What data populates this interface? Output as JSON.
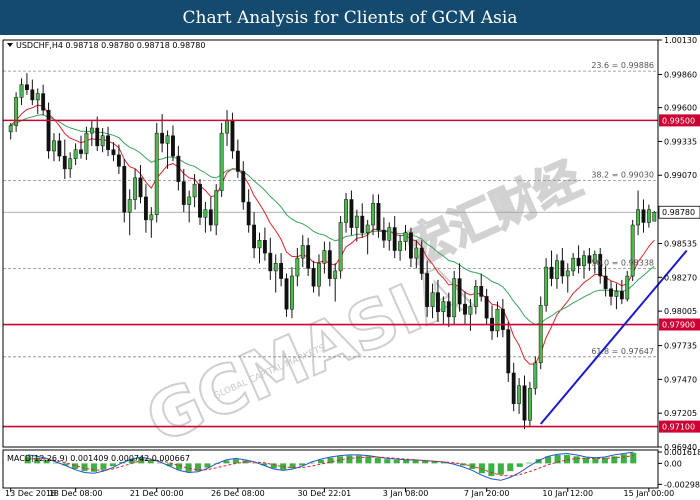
{
  "banner": {
    "title": "Chart Analysis for Clients of GCM Asia"
  },
  "header": {
    "symbol_line": "USDCHF,H4  0.98718 0.98780 0.98718 0.98780",
    "macd_label": "MACD(12,26,9) 0.001409 0.000742 0.000667"
  },
  "watermark": {
    "brand": "GCMASIA",
    "sub": "GLOBAL CAPITAL MARKETS",
    "cn": "宏汇财经"
  },
  "colors": {
    "bull": "#4db84d",
    "bear": "#111111",
    "ema_fast": "#d9262c",
    "ema_slow": "#3aa35c",
    "level": "#cc0033",
    "trend": "#1a1acc",
    "macd_signal": "#d9262c",
    "macd_main": "#2255cc",
    "hist": "#3cb043",
    "banner": "#134a6e"
  },
  "chart_data": {
    "type": "candlestick",
    "symbol": "USDCHF",
    "timeframe": "H4",
    "ylim": [
      0.9694,
      1.0013
    ],
    "price_ticks": [
      "1.00130",
      "0.99860",
      "0.99600",
      "0.99335",
      "0.99070",
      "0.98535",
      "0.98270",
      "0.98005",
      "0.97735",
      "0.97470",
      "0.97205",
      "0.96940"
    ],
    "price_tick_values": [
      1.0013,
      0.9986,
      0.996,
      0.99335,
      0.9907,
      0.98535,
      0.9827,
      0.98005,
      0.97735,
      0.9747,
      0.97205,
      0.9694
    ],
    "x_labels": [
      "13 Dec 2018",
      "18 Dec 08:00",
      "21 Dec 00:00",
      "26 Dec 08:00",
      "30 Dec 22:01",
      "3 Jan 08:00",
      "7 Jan 20:00",
      "10 Jan 12:00",
      "15 Jan 00:00"
    ],
    "x_label_index": [
      0,
      12,
      27,
      42,
      58,
      73,
      88,
      103,
      118
    ],
    "horizontal_levels": [
      {
        "value": 0.995,
        "label": "0.99500"
      },
      {
        "value": 0.979,
        "label": "0.97900"
      },
      {
        "value": 0.971,
        "label": "0.97100"
      }
    ],
    "fibonacci": [
      {
        "ratio": "23.6",
        "value": 0.99886,
        "label": "23.6 = 0.99886"
      },
      {
        "ratio": "38.2",
        "value": 0.9903,
        "label": "38.2 = 0.99030"
      },
      {
        "ratio": "50.0",
        "value": 0.98338,
        "label": "50.0 = 0.98338"
      },
      {
        "ratio": "61.8",
        "value": 0.97647,
        "label": "61.8 = 0.97647"
      }
    ],
    "current_price": {
      "value": 0.9878,
      "label": "0.98780"
    },
    "trendline": [
      {
        "i": 98,
        "p": 0.9712
      },
      {
        "i": 125,
        "p": 0.9848
      }
    ],
    "candles": [
      [
        0.9941,
        0.9948,
        0.9935,
        0.9946
      ],
      [
        0.9946,
        0.9972,
        0.9941,
        0.9968
      ],
      [
        0.9968,
        0.9983,
        0.9962,
        0.9978
      ],
      [
        0.9978,
        0.9987,
        0.997,
        0.9974
      ],
      [
        0.9974,
        0.9982,
        0.9962,
        0.9966
      ],
      [
        0.9966,
        0.9975,
        0.9955,
        0.9971
      ],
      [
        0.9971,
        0.9978,
        0.9954,
        0.9958
      ],
      [
        0.9958,
        0.9964,
        0.992,
        0.9926
      ],
      [
        0.9926,
        0.994,
        0.9918,
        0.9934
      ],
      [
        0.9934,
        0.994,
        0.9918,
        0.9922
      ],
      [
        0.9922,
        0.9935,
        0.9904,
        0.9912
      ],
      [
        0.9912,
        0.9925,
        0.9905,
        0.992
      ],
      [
        0.992,
        0.9932,
        0.9915,
        0.9927
      ],
      [
        0.9927,
        0.9938,
        0.992,
        0.9924
      ],
      [
        0.9924,
        0.9945,
        0.9919,
        0.994
      ],
      [
        0.994,
        0.995,
        0.993,
        0.9944
      ],
      [
        0.9944,
        0.9953,
        0.9926,
        0.993
      ],
      [
        0.993,
        0.9944,
        0.9925,
        0.9938
      ],
      [
        0.9938,
        0.9945,
        0.9922,
        0.9927
      ],
      [
        0.9927,
        0.9933,
        0.9918,
        0.9923
      ],
      [
        0.9923,
        0.9931,
        0.9908,
        0.9914
      ],
      [
        0.9914,
        0.992,
        0.987,
        0.9878
      ],
      [
        0.9878,
        0.9896,
        0.986,
        0.9888
      ],
      [
        0.9888,
        0.9912,
        0.988,
        0.9905
      ],
      [
        0.9905,
        0.9915,
        0.9885,
        0.989
      ],
      [
        0.989,
        0.99,
        0.9862,
        0.9872
      ],
      [
        0.9872,
        0.9882,
        0.9858,
        0.9876
      ],
      [
        0.9876,
        0.9948,
        0.987,
        0.994
      ],
      [
        0.994,
        0.9955,
        0.9925,
        0.9932
      ],
      [
        0.9932,
        0.9942,
        0.9912,
        0.9938
      ],
      [
        0.9938,
        0.9946,
        0.9918,
        0.9922
      ],
      [
        0.9922,
        0.993,
        0.9895,
        0.9902
      ],
      [
        0.9902,
        0.9912,
        0.9878,
        0.9884
      ],
      [
        0.9884,
        0.9895,
        0.987,
        0.989
      ],
      [
        0.989,
        0.9908,
        0.9882,
        0.99
      ],
      [
        0.99,
        0.9904,
        0.9868,
        0.9874
      ],
      [
        0.9874,
        0.9886,
        0.9862,
        0.988
      ],
      [
        0.988,
        0.989,
        0.9863,
        0.9868
      ],
      [
        0.9868,
        0.99,
        0.986,
        0.9895
      ],
      [
        0.9895,
        0.9948,
        0.989,
        0.994
      ],
      [
        0.994,
        0.9958,
        0.993,
        0.995
      ],
      [
        0.995,
        0.9956,
        0.992,
        0.9926
      ],
      [
        0.9926,
        0.9935,
        0.9905,
        0.991
      ],
      [
        0.991,
        0.9918,
        0.988,
        0.9886
      ],
      [
        0.9886,
        0.9896,
        0.9862,
        0.9868
      ],
      [
        0.9868,
        0.9878,
        0.9842,
        0.985
      ],
      [
        0.985,
        0.9862,
        0.9838,
        0.9856
      ],
      [
        0.9856,
        0.9866,
        0.984,
        0.9846
      ],
      [
        0.9846,
        0.9858,
        0.9825,
        0.9832
      ],
      [
        0.9832,
        0.9845,
        0.9815,
        0.9838
      ],
      [
        0.9838,
        0.9846,
        0.982,
        0.9826
      ],
      [
        0.9826,
        0.983,
        0.9796,
        0.9802
      ],
      [
        0.9802,
        0.9835,
        0.9795,
        0.9828
      ],
      [
        0.9828,
        0.985,
        0.982,
        0.9842
      ],
      [
        0.9842,
        0.986,
        0.9835,
        0.9852
      ],
      [
        0.9852,
        0.9858,
        0.9828,
        0.9834
      ],
      [
        0.9834,
        0.984,
        0.9815,
        0.982
      ],
      [
        0.982,
        0.9845,
        0.9812,
        0.9838
      ],
      [
        0.9838,
        0.9855,
        0.983,
        0.9848
      ],
      [
        0.9848,
        0.9855,
        0.982,
        0.9826
      ],
      [
        0.9826,
        0.9838,
        0.9808,
        0.9832
      ],
      [
        0.9832,
        0.9875,
        0.9826,
        0.987
      ],
      [
        0.987,
        0.9893,
        0.9862,
        0.9888
      ],
      [
        0.9888,
        0.9895,
        0.986,
        0.9866
      ],
      [
        0.9866,
        0.988,
        0.9855,
        0.9875
      ],
      [
        0.9875,
        0.9885,
        0.9858,
        0.9862
      ],
      [
        0.9862,
        0.9872,
        0.9845,
        0.9868
      ],
      [
        0.9868,
        0.9892,
        0.986,
        0.9885
      ],
      [
        0.9885,
        0.9892,
        0.9858,
        0.9864
      ],
      [
        0.9864,
        0.9874,
        0.985,
        0.9856
      ],
      [
        0.9856,
        0.987,
        0.9848,
        0.9866
      ],
      [
        0.9866,
        0.9875,
        0.9842,
        0.9848
      ],
      [
        0.9848,
        0.986,
        0.984,
        0.9855
      ],
      [
        0.9855,
        0.9868,
        0.9848,
        0.9862
      ],
      [
        0.9862,
        0.9866,
        0.9835,
        0.9842
      ],
      [
        0.9842,
        0.9856,
        0.9834,
        0.985
      ],
      [
        0.985,
        0.9856,
        0.9825,
        0.983
      ],
      [
        0.983,
        0.984,
        0.9796,
        0.9804
      ],
      [
        0.9804,
        0.9822,
        0.9795,
        0.9815
      ],
      [
        0.9815,
        0.9825,
        0.9792,
        0.98
      ],
      [
        0.98,
        0.9812,
        0.979,
        0.9808
      ],
      [
        0.9808,
        0.9815,
        0.9788,
        0.9796
      ],
      [
        0.9796,
        0.9832,
        0.979,
        0.9826
      ],
      [
        0.9826,
        0.9838,
        0.98,
        0.9806
      ],
      [
        0.9806,
        0.9816,
        0.979,
        0.9798
      ],
      [
        0.9798,
        0.981,
        0.9785,
        0.9804
      ],
      [
        0.9804,
        0.9825,
        0.9798,
        0.982
      ],
      [
        0.982,
        0.983,
        0.9808,
        0.9812
      ],
      [
        0.9812,
        0.9818,
        0.979,
        0.9795
      ],
      [
        0.9795,
        0.9805,
        0.9778,
        0.9785
      ],
      [
        0.9785,
        0.9808,
        0.978,
        0.9802
      ],
      [
        0.9802,
        0.981,
        0.978,
        0.9786
      ],
      [
        0.9786,
        0.9792,
        0.9745,
        0.9752
      ],
      [
        0.9752,
        0.976,
        0.9722,
        0.9728
      ],
      [
        0.9728,
        0.9748,
        0.972,
        0.9742
      ],
      [
        0.9742,
        0.975,
        0.9708,
        0.9715
      ],
      [
        0.9715,
        0.9745,
        0.971,
        0.974
      ],
      [
        0.974,
        0.9765,
        0.9735,
        0.976
      ],
      [
        0.976,
        0.9812,
        0.9755,
        0.9805
      ],
      [
        0.9805,
        0.9842,
        0.98,
        0.9835
      ],
      [
        0.9835,
        0.9848,
        0.982,
        0.9826
      ],
      [
        0.9826,
        0.9845,
        0.9818,
        0.984
      ],
      [
        0.984,
        0.985,
        0.9822,
        0.9828
      ],
      [
        0.9828,
        0.9838,
        0.9815,
        0.9832
      ],
      [
        0.9832,
        0.9846,
        0.9828,
        0.9842
      ],
      [
        0.9842,
        0.9852,
        0.983,
        0.9836
      ],
      [
        0.9836,
        0.9848,
        0.9826,
        0.9844
      ],
      [
        0.9844,
        0.985,
        0.9832,
        0.9838
      ],
      [
        0.9838,
        0.9848,
        0.983,
        0.9845
      ],
      [
        0.9845,
        0.985,
        0.9822,
        0.9828
      ],
      [
        0.9828,
        0.9836,
        0.9812,
        0.9818
      ],
      [
        0.9818,
        0.9824,
        0.9805,
        0.9812
      ],
      [
        0.9812,
        0.9822,
        0.9802,
        0.9816
      ],
      [
        0.9816,
        0.9825,
        0.9806,
        0.981
      ],
      [
        0.981,
        0.9832,
        0.9808,
        0.9828
      ],
      [
        0.9828,
        0.9872,
        0.9824,
        0.9868
      ],
      [
        0.9868,
        0.9895,
        0.986,
        0.988
      ],
      [
        0.988,
        0.9888,
        0.9862,
        0.987
      ],
      [
        0.987,
        0.9884,
        0.9866,
        0.988
      ],
      [
        0.9871,
        0.9879,
        0.9871,
        0.9878
      ]
    ],
    "macd": {
      "label": "MACD(12,26,9)",
      "ylim": [
        -0.0035,
        0.0019
      ],
      "ticks": [
        "0.001618",
        "0.00",
        "-0.00298"
      ],
      "tick_values": [
        0.001618,
        0.0,
        -0.00298
      ],
      "hist": [
        0.001,
        0.0008,
        0.0005,
        0.0001,
        -0.0003,
        -0.0008,
        -0.0011,
        -0.0012,
        -0.0009,
        -0.0004,
        0.0002,
        0.0006,
        0.0008,
        0.0005,
        0.0001,
        -0.0004,
        -0.0009,
        -0.0012,
        -0.0011,
        -0.0006,
        0.0,
        0.0004,
        0.0006,
        0.0004,
        0.0001,
        -0.0003,
        -0.0007,
        -0.0009,
        -0.0007,
        -0.0003,
        0.0001,
        0.0005,
        0.0008,
        0.001,
        0.0011,
        0.0011,
        0.001,
        0.0008,
        0.0006,
        0.0005,
        0.0005,
        0.0005,
        0.0004,
        0.0003,
        0.0002,
        0.0,
        -0.0003,
        -0.0008,
        -0.0014,
        -0.0018,
        -0.0016,
        -0.0011,
        -0.0005,
        0.0001,
        0.0006,
        0.001,
        0.0012,
        0.0012,
        0.001,
        0.0008,
        0.0007,
        0.0008,
        0.001,
        0.0013,
        0.0015
      ],
      "signal": [
        0.0006,
        0.0007,
        0.0006,
        0.0004,
        0.0001,
        -0.0003,
        -0.0007,
        -0.0009,
        -0.001,
        -0.0008,
        -0.0004,
        0.0,
        0.0004,
        0.0005,
        0.0004,
        0.0001,
        -0.0003,
        -0.0007,
        -0.0009,
        -0.0009,
        -0.0006,
        -0.0003,
        0.0,
        0.0002,
        0.0002,
        0.0001,
        -0.0002,
        -0.0005,
        -0.0006,
        -0.0006,
        -0.0004,
        -0.0001,
        0.0002,
        0.0005,
        0.0007,
        0.0008,
        0.0009,
        0.0009,
        0.0008,
        0.0007,
        0.0006,
        0.0005,
        0.0004,
        0.0003,
        0.0002,
        0.0001,
        -0.0001,
        -0.0004,
        -0.0008,
        -0.0013,
        -0.0017,
        -0.0018,
        -0.0016,
        -0.0012,
        -0.0007,
        -0.0002,
        0.0002,
        0.0005,
        0.0007,
        0.0007,
        0.0007,
        0.0007,
        0.0008,
        0.0009,
        0.0011
      ],
      "main": [
        0.0012,
        0.001,
        0.0007,
        0.0002,
        -0.0003,
        -0.0009,
        -0.0013,
        -0.0014,
        -0.0011,
        -0.0006,
        0.0001,
        0.0006,
        0.0009,
        0.0006,
        0.0002,
        -0.0004,
        -0.001,
        -0.0013,
        -0.0012,
        -0.0007,
        0.0,
        0.0005,
        0.0007,
        0.0005,
        0.0002,
        -0.0003,
        -0.0008,
        -0.001,
        -0.0008,
        -0.0004,
        0.0002,
        0.0006,
        0.0009,
        0.0011,
        0.0012,
        0.0012,
        0.0011,
        0.0009,
        0.0007,
        0.0006,
        0.0005,
        0.0005,
        0.0004,
        0.0003,
        0.0002,
        -0.0001,
        -0.0005,
        -0.001,
        -0.0017,
        -0.0022,
        -0.0024,
        -0.002,
        -0.0013,
        -0.0004,
        0.0004,
        0.001,
        0.0013,
        0.0014,
        0.0012,
        0.0009,
        0.0008,
        0.0009,
        0.0012,
        0.0014,
        0.0016
      ]
    }
  }
}
